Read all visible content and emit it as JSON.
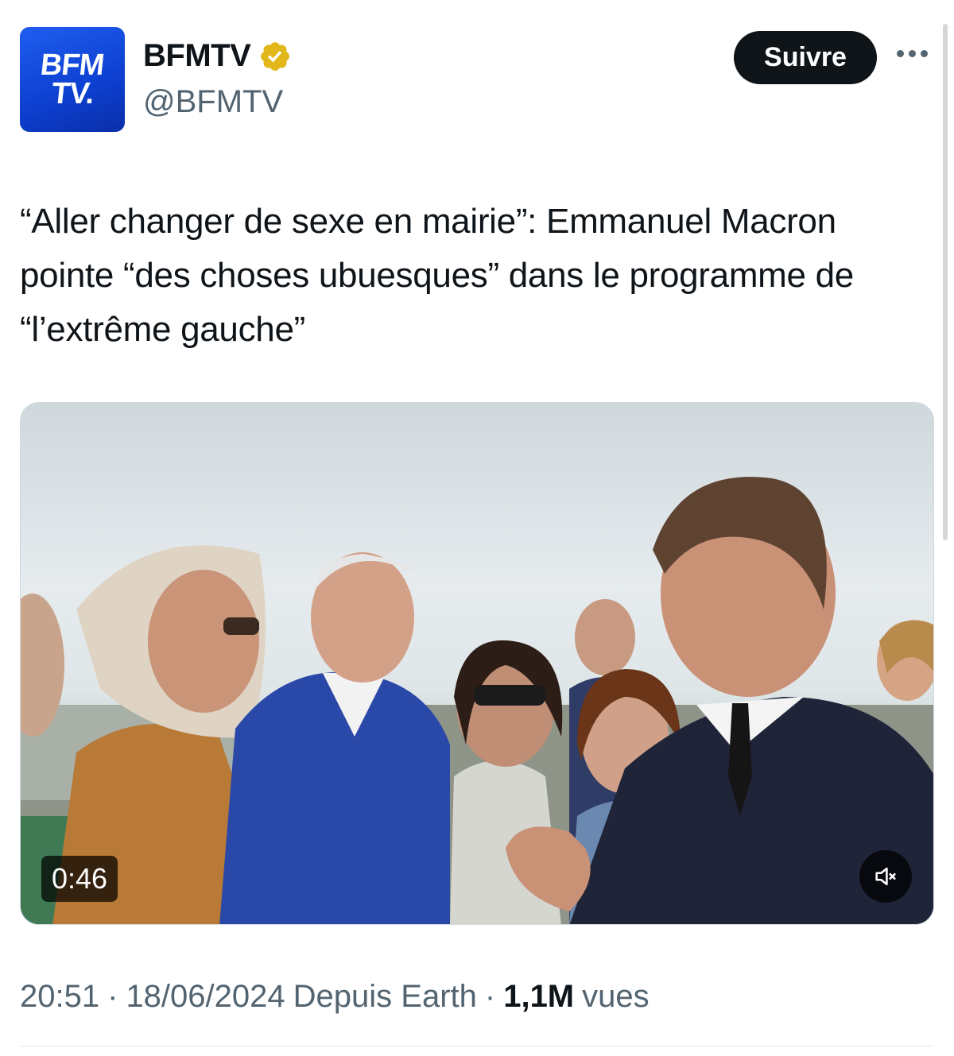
{
  "author": {
    "avatar_text_line1": "BFM",
    "avatar_text_line2": "TV.",
    "display_name": "BFMTV",
    "handle": "@BFMTV",
    "verified_icon": "verified-badge-gold",
    "avatar_color": "#1a4fe0"
  },
  "actions": {
    "follow_label": "Suivre",
    "more_icon": "more-horizontal-icon"
  },
  "tweet": {
    "text": "“Aller changer de sexe en mairie”: Emmanuel Macron pointe “des choses ubuesques” dans le programme de “l’extrême gauche”"
  },
  "media": {
    "duration": "0:46",
    "mute_icon": "speaker-muted-icon"
  },
  "meta": {
    "time": "20:51",
    "date": "18/06/2024",
    "source": "Depuis Earth",
    "views_count": "1,1M",
    "views_label": "vues"
  },
  "colors": {
    "text_primary": "#0f1419",
    "text_secondary": "#536471",
    "verified_gold": "#e2b719",
    "follow_bg": "#0f1419"
  }
}
